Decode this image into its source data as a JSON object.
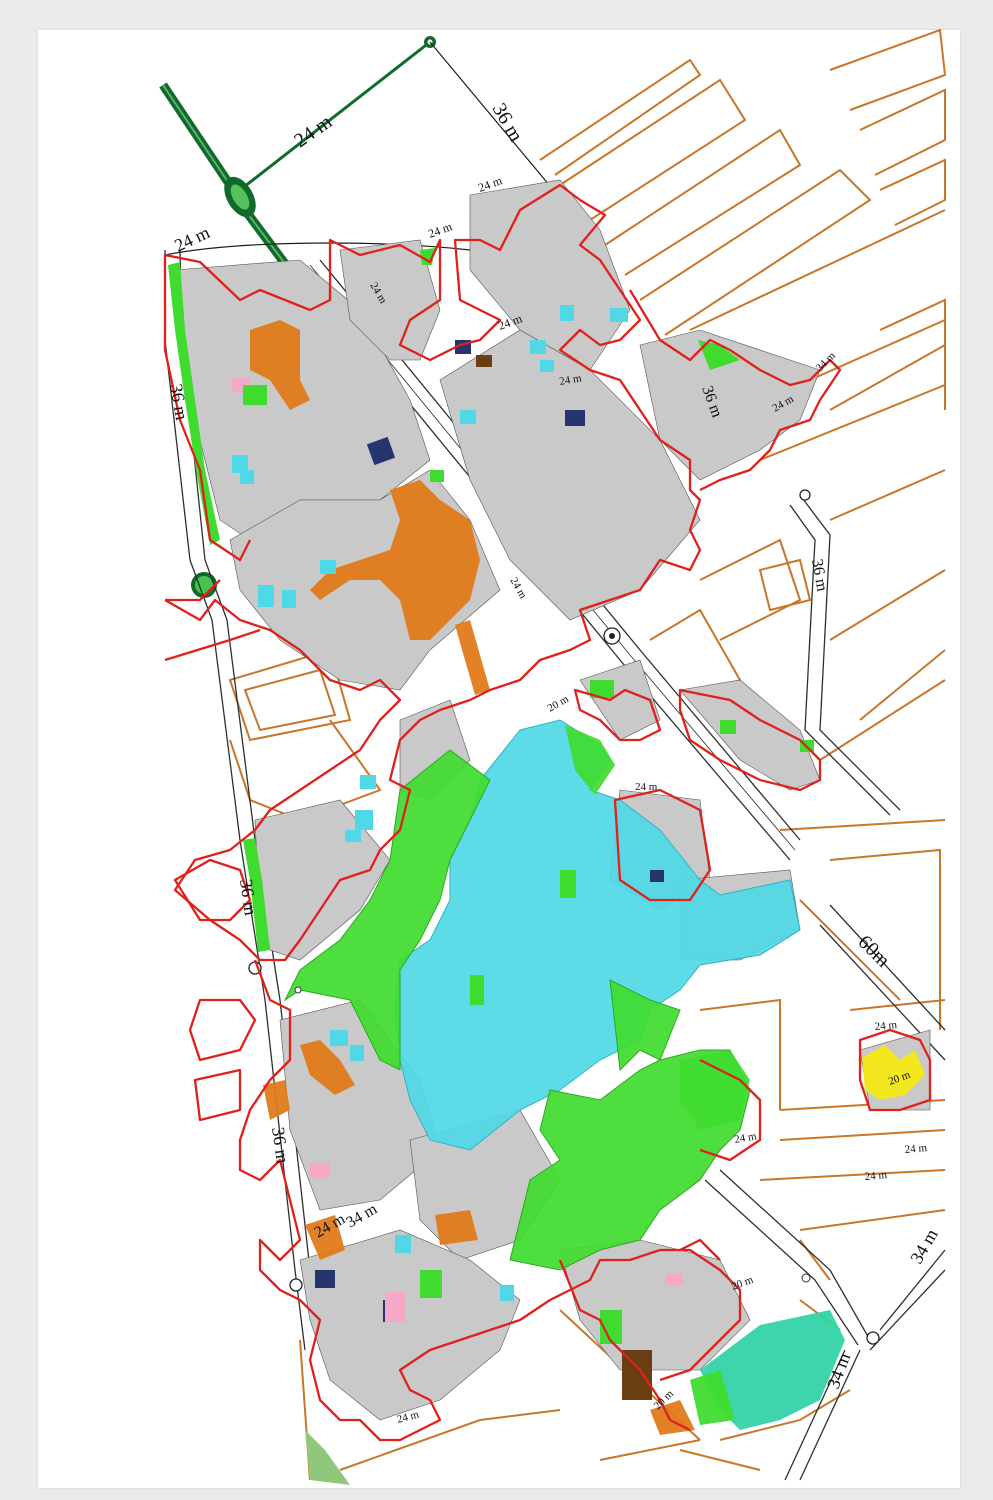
{
  "map": {
    "road_labels": {
      "north_24m": "24 m",
      "north_36m": "36 m",
      "nw_24m": "24 m",
      "west_36m_upper": "36 m",
      "west_36m_middle": "36 m",
      "west_36m_lower": "36 m",
      "east_36m_upper": "36 m",
      "east_36m_right": "36 m",
      "east_60m": "60m",
      "south_24m": "24 m",
      "south_34m": "34 m",
      "se_24m_a": "24 m",
      "se_24m_b": "24 m",
      "se_24m_c": "24 m",
      "se_20m": "20 m",
      "se_24m_d": "24 m",
      "far_se_34m_a": "34 m",
      "far_se_34m_b": "34 m",
      "inner_24m_a": "24 m",
      "inner_24m_b": "24 m",
      "inner_24m_c": "24 m",
      "inner_24m_d": "24 m",
      "inner_24m_e": "24 m",
      "inner_24m_f": "24 m",
      "inner_24m_g": "24 m",
      "inner_24m_h": "24 m",
      "inner_20m": "20 m",
      "inner_20m_b": "20 m",
      "inner_34m": "34 m",
      "bottom_24m": "24 m",
      "bottom_20m": "20 m"
    },
    "colors": {
      "paper": "#ffffff",
      "viewer_background": "#ebebeb",
      "planning_boundary": "#e0211b",
      "future_roads": "#c8762a",
      "residential_blocks": "#c9c9c9",
      "commercial": "#e07a1a",
      "green_space": "#3fdc2f",
      "residential_zone": "#4fd9e6",
      "education": "#3fd4d4",
      "public_service": "#26356e",
      "health": "#f6a8c8",
      "sports": "#f2e81d",
      "religious": "#6b3d12",
      "teal_zone": "#35d3a8",
      "highway": "#0e6b2c"
    },
    "legend_items": [],
    "icons": [
      "roundabout-icon"
    ]
  }
}
